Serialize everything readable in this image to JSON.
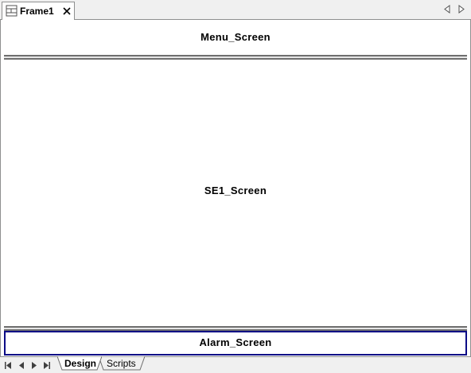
{
  "document_tab": {
    "label": "Frame1",
    "icon": "frame-icon"
  },
  "panes": {
    "menu": "Menu_Screen",
    "main": "SE1_Screen",
    "alarm": "Alarm_Screen"
  },
  "sheet_tabs": [
    {
      "label": "Design",
      "active": true
    },
    {
      "label": "Scripts",
      "active": false
    }
  ],
  "colors": {
    "selection_border": "#0b0b86",
    "splitter": "#6f6f6f",
    "chrome": "#f0f0f0"
  }
}
